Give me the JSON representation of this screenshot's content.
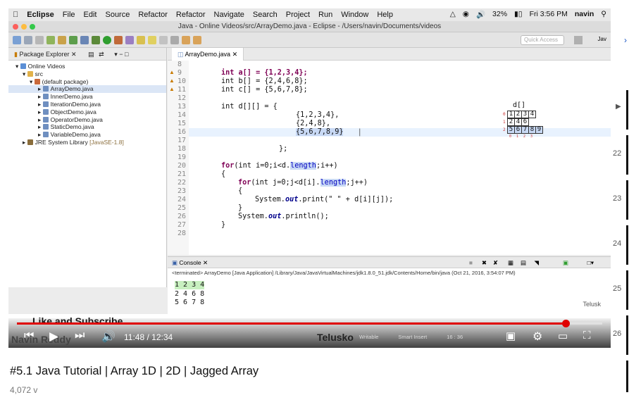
{
  "mac_menubar": {
    "apple": "",
    "items": [
      "Eclipse",
      "File",
      "Edit",
      "Source",
      "Refactor",
      "Refactor",
      "Navigate",
      "Search",
      "Project",
      "Run",
      "Window",
      "Help"
    ],
    "battery": "32%",
    "clock": "Fri 3:56 PM",
    "user": "navin"
  },
  "window": {
    "title": "Java - Online Videos/src/ArrayDemo.java - Eclipse - /Users/navin/Documents/videos"
  },
  "toolbar": {
    "quick_access_placeholder": "Quick Access",
    "perspective_label": "Jav"
  },
  "package_explorer": {
    "title": "Package Explorer",
    "tree": [
      {
        "label": "Online Videos",
        "depth": 0,
        "icon": "project-icon"
      },
      {
        "label": "src",
        "depth": 1,
        "icon": "folder-icon"
      },
      {
        "label": "(default package)",
        "depth": 2,
        "icon": "package-icon"
      },
      {
        "label": "ArrayDemo.java",
        "depth": 3,
        "icon": "java-file-icon",
        "selected": true
      },
      {
        "label": "InnerDemo.java",
        "depth": 3,
        "icon": "java-file-icon"
      },
      {
        "label": "IterationDemo.java",
        "depth": 3,
        "icon": "java-file-icon"
      },
      {
        "label": "ObjectDemo.java",
        "depth": 3,
        "icon": "java-file-icon"
      },
      {
        "label": "OperatorDemo.java",
        "depth": 3,
        "icon": "java-file-icon"
      },
      {
        "label": "StaticDemo.java",
        "depth": 3,
        "icon": "java-file-icon"
      },
      {
        "label": "VariableDemo.java",
        "depth": 3,
        "icon": "java-file-icon"
      },
      {
        "label": "JRE System Library",
        "depth": 0,
        "icon": "library-icon",
        "suffix": "[JavaSE-1.8]"
      }
    ]
  },
  "editor": {
    "tab_label": "ArrayDemo.java",
    "line_numbers": [
      "8",
      "9",
      "10",
      "11",
      "12",
      "13",
      "14",
      "15",
      "16",
      "17",
      "18",
      "19",
      "20",
      "21",
      "22",
      "23",
      "24",
      "25",
      "26",
      "27",
      "28"
    ],
    "code": {
      "l9": "int a[] = {1,2,3,4};",
      "l10": "int b[] = {2,4,6,8};",
      "l11": "int c[] = {5,6,7,8};",
      "l13": "int d[][] = {",
      "l14": "{1,2,3,4},",
      "l15": "{2,4,8},",
      "l16": "{5,6,7,8,9}",
      "l18": "};",
      "l20_kw": "for",
      "l20_a": "(int i=0;i<d.",
      "l20_len": "length",
      "l20_b": ";i++)",
      "l21": "{",
      "l22_kw": "for",
      "l22_a": "(int j=0;j<d[i].",
      "l22_len": "length",
      "l22_b": ";j++)",
      "l23": "{",
      "l24_a": "System.",
      "l24_out": "out",
      "l24_b": ".print(\" \" + d[i][j]);",
      "l25": "}",
      "l26_a": "System.",
      "l26_out": "out",
      "l26_b": ".println();",
      "l27": "}"
    },
    "diagram": {
      "label": "d[]",
      "rows": [
        [
          "1",
          "2",
          "3",
          "4"
        ],
        [
          "2",
          "4",
          "6"
        ],
        [
          "5",
          "6",
          "7",
          "8",
          "9"
        ]
      ],
      "row_index": [
        "0",
        "1",
        "2"
      ],
      "col_index": [
        "0",
        "1",
        "2",
        "3"
      ]
    }
  },
  "console": {
    "title": "Console",
    "terminated": "<terminated> ArrayDemo [Java Application] /Library/Java/JavaVirtualMachines/jdk1.8.0_51.jdk/Contents/Home/bin/java (Oct 21, 2016, 3:54:07 PM)",
    "output": [
      "1 2 3 4",
      "2 4 6 8",
      "5 6 7 8"
    ],
    "watermark": "Telusk"
  },
  "player": {
    "overlay_text": "Like and Subscribe",
    "presenter": "Navin Reddy",
    "current_time": "11:48",
    "duration": "12:34",
    "time_display": "11:48 / 12:34",
    "progress": 0.938,
    "brand": "Telusko",
    "status_writable": "Writable",
    "status_insert": "Smart Insert",
    "status_pos": "16 : 36"
  },
  "side_column": {
    "numbers": [
      "22",
      "23",
      "24",
      "25",
      "26"
    ]
  },
  "video_title": "#5.1 Java Tutorial | Array 1D | 2D | Jagged Array",
  "views_partial": "4,072 v"
}
